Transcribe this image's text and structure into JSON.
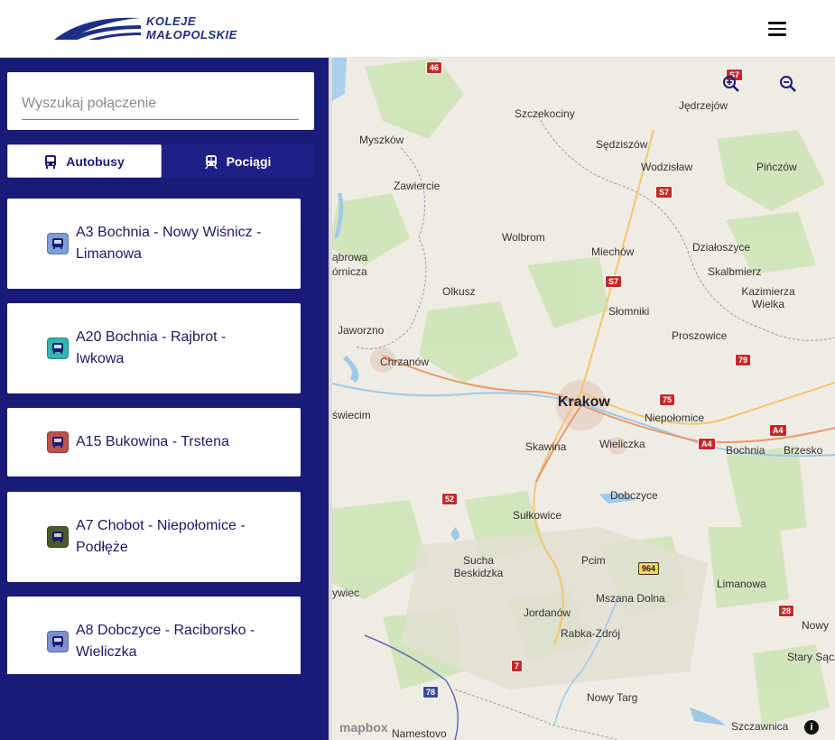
{
  "header": {
    "logo_line1": "KOLEJE",
    "logo_line2": "MAŁOPOLSKIE",
    "menu_icon": "hamburger-icon"
  },
  "search": {
    "placeholder": "Wyszukaj połączenie",
    "value": ""
  },
  "tabs": [
    {
      "label": "Autobusy",
      "icon": "bus-icon",
      "active": true
    },
    {
      "label": "Pociągi",
      "icon": "train-icon",
      "active": false
    }
  ],
  "routes": [
    {
      "label": "A3 Bochnia - Nowy Wiśnicz - Limanowa",
      "color": "#7fa0d6"
    },
    {
      "label": "A20 Bochnia - Rajbrot - Iwkowa",
      "color": "#2fb6b0"
    },
    {
      "label": "A15 Bukowina - Trstena",
      "color": "#c0504d"
    },
    {
      "label": "A7 Chobot - Niepołomice - Podłęże",
      "color": "#4a5a2a"
    },
    {
      "label": "A8 Dobczyce - Raciborsko - Wieliczka",
      "color": "#7f8fd0"
    }
  ],
  "map": {
    "cities": [
      "Szczekociny",
      "Jędrzejów",
      "Myszków",
      "Sędziszów",
      "Wodzisław",
      "Pińczów",
      "Zawiercie",
      "Wolbrom",
      "Miechów",
      "Działoszyce",
      "Skalbmierz",
      "Kazimierza Wielka",
      "Olkusz",
      "Słomniki",
      "Jaworzno",
      "Proszowice",
      "Chrzanów",
      "Krakow",
      "Niepołomice",
      "Skawina",
      "Wieliczka",
      "Bochnia",
      "Brzesko",
      "Dobczyce",
      "Sułkowice",
      "Sucha Beskidzka",
      "Pcim",
      "Limanowa",
      "Mszana Dolna",
      "Jordanów",
      "Rabka-Zdrój",
      "Nowy Targ",
      "Szczawnica",
      "Stary Sącz",
      "Nowy",
      "Namestovo",
      "ywiec",
      "świecim",
      "ąbrowa",
      "órnicza"
    ],
    "roads": [
      "46",
      "S7",
      "S7",
      "S7",
      "79",
      "75",
      "A4",
      "A4",
      "52",
      "964",
      "28",
      "7",
      "78"
    ],
    "attribution": "mapbox",
    "zoom_in_icon": "zoom-in-icon",
    "zoom_out_icon": "zoom-out-icon",
    "info_icon": "info-icon"
  }
}
